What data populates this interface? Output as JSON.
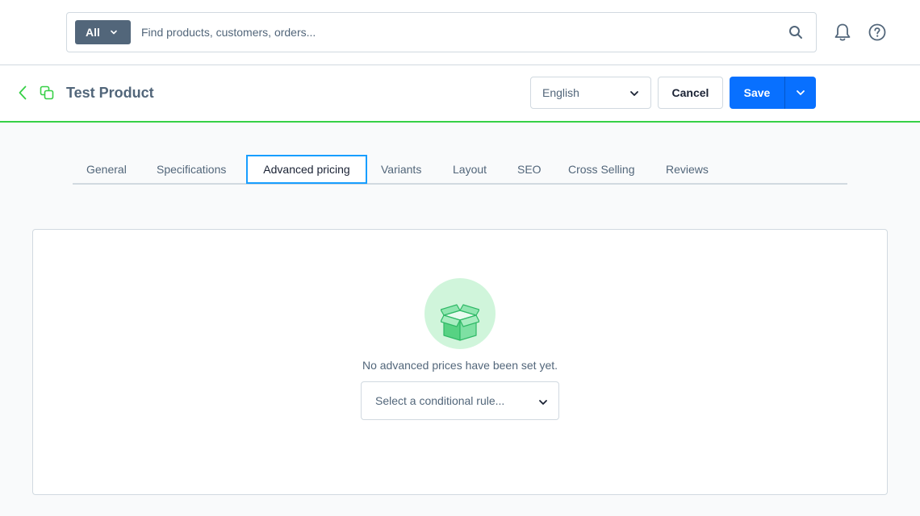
{
  "search": {
    "type_label": "All",
    "placeholder": "Find products, customers, orders..."
  },
  "header": {
    "title": "Test Product",
    "language": "English",
    "cancel_label": "Cancel",
    "save_label": "Save"
  },
  "tabs": [
    {
      "label": "General",
      "active": false
    },
    {
      "label": "Specifications",
      "active": false
    },
    {
      "label": "Advanced pricing",
      "active": true
    },
    {
      "label": "Variants",
      "active": false
    },
    {
      "label": "Layout",
      "active": false
    },
    {
      "label": "SEO",
      "active": false
    },
    {
      "label": "Cross Selling",
      "active": false
    },
    {
      "label": "Reviews",
      "active": false
    }
  ],
  "empty_state": {
    "message": "No advanced prices have been set yet.",
    "rule_select_placeholder": "Select a conditional rule..."
  },
  "colors": {
    "primary": "#0870ff",
    "accent_green": "#37d046",
    "text": "#52667a",
    "active_tab_border": "#189eff"
  },
  "icons": [
    "search-icon",
    "bell-icon",
    "help-icon",
    "back-icon",
    "variant-icon",
    "box-icon",
    "chevron-down-icon"
  ]
}
